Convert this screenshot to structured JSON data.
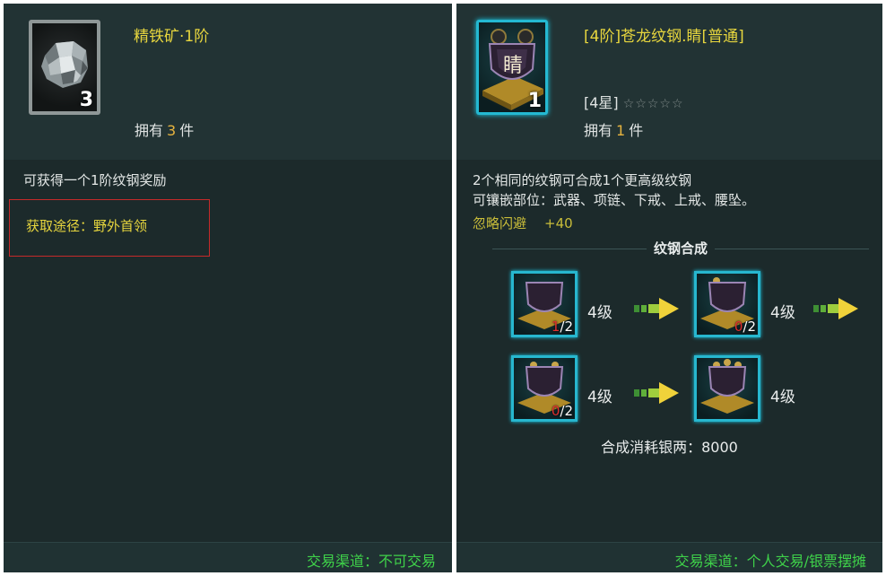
{
  "left_panel": {
    "item_name": "精铁矿·1阶",
    "stack_count": "3",
    "own_prefix": "拥有",
    "own_count": "3",
    "own_suffix": "件",
    "description": "可获得一个1阶纹钢奖励",
    "route": "获取途径：野外首领",
    "trade": "交易渠道：不可交易"
  },
  "right_panel": {
    "item_name": "[4阶]苍龙纹钢.睛[普通]",
    "stack_count": "1",
    "emblem_char": "睛",
    "star_tag": "[4星]",
    "stars": "☆☆☆☆☆",
    "own_prefix": "拥有",
    "own_count": "1",
    "own_suffix": "件",
    "desc_line1": "2个相同的纹钢可合成1个更高级纹钢",
    "desc_line2": "可镶嵌部位：武器、项链、下戒、上戒、腰坠。",
    "bonus_label": "忽略闪避",
    "bonus_value": "+40",
    "synth_title": "纹钢合成",
    "synth_rows": [
      {
        "a_have": "1",
        "a_need": "/2",
        "a_level": "4级",
        "b_have": "0",
        "b_need": "/2",
        "b_level": "4级"
      },
      {
        "a_have": "0",
        "a_need": "/2",
        "a_level": "4级",
        "b_level": "4级"
      }
    ],
    "cost": "合成消耗银两：8000",
    "trade": "交易渠道：个人交易/银票摆摊"
  },
  "colors": {
    "panel_bg": "#1c2a2b",
    "title_yellow": "#e7d63e",
    "trade_green": "#3fd24a",
    "frame_cyan": "#24b9d2",
    "count_red": "#e02f2f",
    "highlight_box": "#c62a2a"
  },
  "icons": [
    "iron-ore-icon",
    "dragon-steel-icon",
    "synthesis-arrow-icon",
    "star-icon"
  ]
}
